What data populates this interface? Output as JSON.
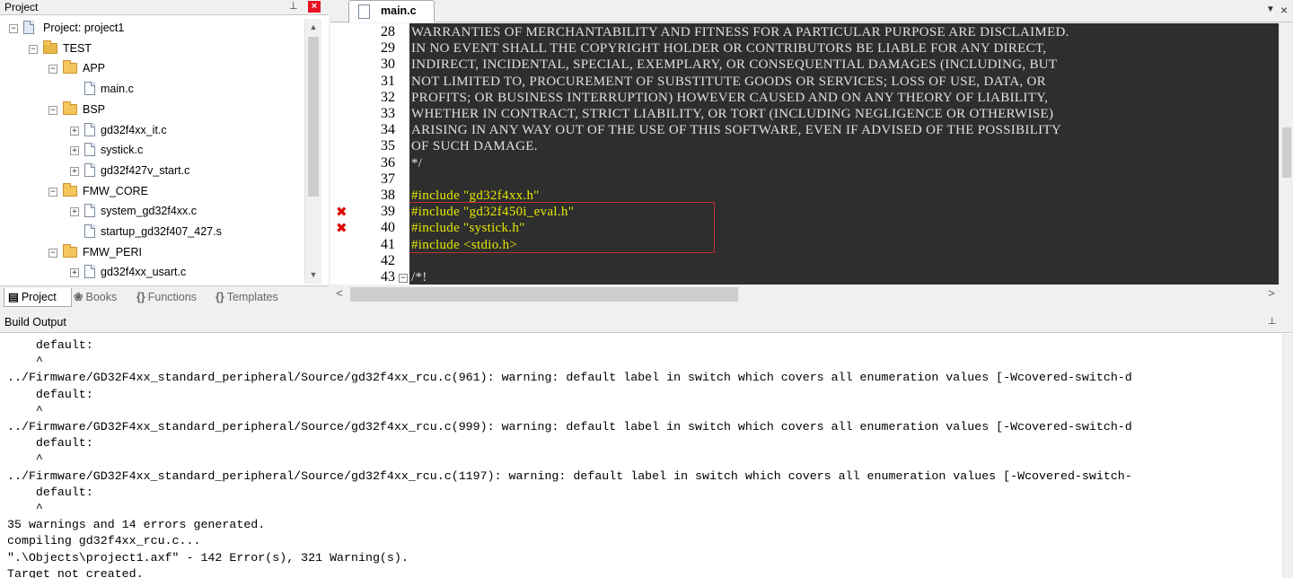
{
  "project_panel": {
    "title": "Project",
    "pin": "⊥",
    "close": "×",
    "tree": [
      {
        "label": "Project: project1",
        "type": "project",
        "level": 0,
        "expander": "−"
      },
      {
        "label": "TEST",
        "type": "target",
        "level": 1,
        "expander": "−"
      },
      {
        "label": "APP",
        "type": "folder",
        "level": 2,
        "expander": "−"
      },
      {
        "label": "main.c",
        "type": "file",
        "level": 3,
        "expander": ""
      },
      {
        "label": "BSP",
        "type": "folder",
        "level": 2,
        "expander": "−"
      },
      {
        "label": "gd32f4xx_it.c",
        "type": "file",
        "level": 3,
        "expander": "+"
      },
      {
        "label": "systick.c",
        "type": "file",
        "level": 3,
        "expander": "+"
      },
      {
        "label": "gd32f427v_start.c",
        "type": "file",
        "level": 3,
        "expander": "+"
      },
      {
        "label": "FMW_CORE",
        "type": "folder",
        "level": 2,
        "expander": "−"
      },
      {
        "label": "system_gd32f4xx.c",
        "type": "file",
        "level": 3,
        "expander": "+"
      },
      {
        "label": "startup_gd32f407_427.s",
        "type": "file",
        "level": 3,
        "expander": ""
      },
      {
        "label": "FMW_PERI",
        "type": "folder",
        "level": 2,
        "expander": "−"
      },
      {
        "label": "gd32f4xx_usart.c",
        "type": "file",
        "level": 3,
        "expander": "+"
      }
    ],
    "tabs": [
      {
        "label": "Project",
        "icon": "▤",
        "active": true
      },
      {
        "label": "Books",
        "icon": "❀",
        "active": false
      },
      {
        "label": "Functions",
        "icon": "{}",
        "active": false
      },
      {
        "label": "Templates",
        "icon": "{}",
        "active": false
      }
    ]
  },
  "editor": {
    "tab_label": "main.c",
    "tab_menu_icon": "▼",
    "tab_close_icon": "×",
    "lines": [
      {
        "num": "28",
        "text": "WARRANTIES OF MERCHANTABILITY AND FITNESS FOR A PARTICULAR PURPOSE ARE DISCLAIMED.",
        "kind": "comment",
        "error": false
      },
      {
        "num": "29",
        "text": "IN NO EVENT SHALL THE COPYRIGHT HOLDER OR CONTRIBUTORS BE LIABLE FOR ANY DIRECT,",
        "kind": "comment",
        "error": false
      },
      {
        "num": "30",
        "text": "INDIRECT, INCIDENTAL, SPECIAL, EXEMPLARY, OR CONSEQUENTIAL DAMAGES (INCLUDING, BUT",
        "kind": "comment",
        "error": false
      },
      {
        "num": "31",
        "text": "NOT LIMITED TO, PROCUREMENT OF SUBSTITUTE GOODS OR SERVICES; LOSS OF USE, DATA, OR",
        "kind": "comment",
        "error": false
      },
      {
        "num": "32",
        "text": "PROFITS; OR BUSINESS INTERRUPTION) HOWEVER CAUSED AND ON ANY THEORY OF LIABILITY,",
        "kind": "comment",
        "error": false
      },
      {
        "num": "33",
        "text": "WHETHER IN CONTRACT, STRICT LIABILITY, OR TORT (INCLUDING NEGLIGENCE OR OTHERWISE)",
        "kind": "comment",
        "error": false
      },
      {
        "num": "34",
        "text": "ARISING IN ANY WAY OUT OF THE USE OF THIS SOFTWARE, EVEN IF ADVISED OF THE POSSIBILITY",
        "kind": "comment",
        "error": false
      },
      {
        "num": "35",
        "text": "OF SUCH DAMAGE.",
        "kind": "comment",
        "error": false
      },
      {
        "num": "36",
        "text": "*/",
        "kind": "comment",
        "error": false
      },
      {
        "num": "37",
        "text": "",
        "kind": "comment",
        "error": false
      },
      {
        "num": "38",
        "text": "#include \"gd32f4xx.h\"",
        "kind": "include",
        "error": false
      },
      {
        "num": "39",
        "text": "#include \"gd32f450i_eval.h\"",
        "kind": "include",
        "error": true
      },
      {
        "num": "40",
        "text": "#include \"systick.h\"",
        "kind": "include",
        "error": true
      },
      {
        "num": "41",
        "text": "#include <stdio.h>",
        "kind": "include",
        "error": false
      },
      {
        "num": "42",
        "text": "",
        "kind": "comment",
        "error": false
      },
      {
        "num": "43",
        "text": "/*!",
        "kind": "comment",
        "error": false
      }
    ],
    "error_marker": "✖",
    "fold_marker": "−"
  },
  "build_output": {
    "title": "Build Output",
    "pin": "⊥",
    "lines": [
      "    default:",
      "    ^",
      "../Firmware/GD32F4xx_standard_peripheral/Source/gd32f4xx_rcu.c(961): warning: default label in switch which covers all enumeration values [-Wcovered-switch-d",
      "    default:",
      "    ^",
      "../Firmware/GD32F4xx_standard_peripheral/Source/gd32f4xx_rcu.c(999): warning: default label in switch which covers all enumeration values [-Wcovered-switch-d",
      "    default:",
      "    ^",
      "../Firmware/GD32F4xx_standard_peripheral/Source/gd32f4xx_rcu.c(1197): warning: default label in switch which covers all enumeration values [-Wcovered-switch-",
      "    default:",
      "    ^",
      "35 warnings and 14 errors generated.",
      "compiling gd32f4xx_rcu.c...",
      "\".\\Objects\\project1.axf\" - 142 Error(s), 321 Warning(s).",
      "Target not created."
    ]
  },
  "scroll_arrows": {
    "up": "▲",
    "down": "▼",
    "left": "<",
    "right": ">"
  }
}
